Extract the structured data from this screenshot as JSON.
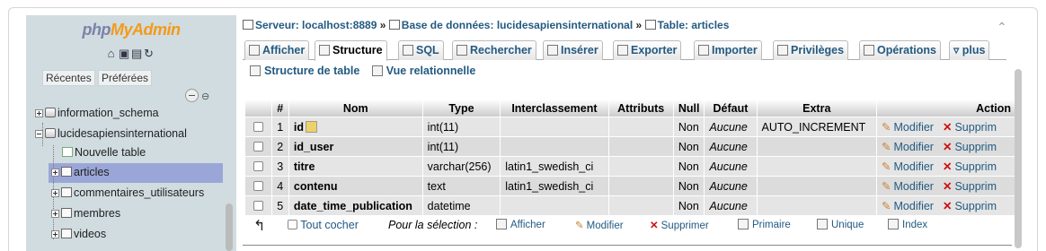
{
  "sidebar": {
    "logo": {
      "php": "php",
      "my": "My",
      "admin": "Admin"
    },
    "tabs": {
      "recent": "Récentes",
      "favorites": "Préférées"
    },
    "tree": [
      {
        "label": "information_schema",
        "kind": "database"
      },
      {
        "label": "lucidesapiensinternational",
        "kind": "database"
      },
      {
        "label": "Nouvelle table",
        "kind": "new"
      },
      {
        "label": "articles",
        "kind": "table",
        "selected": true
      },
      {
        "label": "commentaires_utilisateurs",
        "kind": "table"
      },
      {
        "label": "membres",
        "kind": "table"
      },
      {
        "label": "videos",
        "kind": "table"
      }
    ]
  },
  "breadcrumb": {
    "server": "Serveur: localhost:8889",
    "database": "Base de données: lucidesapiensinternational",
    "table": "Table: articles",
    "sep": "»"
  },
  "tabs": [
    "Afficher",
    "Structure",
    "SQL",
    "Rechercher",
    "Insérer",
    "Exporter",
    "Importer",
    "Privilèges",
    "Opérations",
    "plus"
  ],
  "active_tab": "Structure",
  "subtabs": [
    "Structure de table",
    "Vue relationnelle"
  ],
  "table": {
    "headers": [
      "#",
      "Nom",
      "Type",
      "Interclassement",
      "Attributs",
      "Null",
      "Défaut",
      "Extra",
      "Action"
    ],
    "rows": [
      {
        "num": "1",
        "name": "id",
        "type": "int(11)",
        "collation": "",
        "attributes": "",
        "null": "Non",
        "default": "Aucune",
        "extra": "AUTO_INCREMENT",
        "primary": true
      },
      {
        "num": "2",
        "name": "id_user",
        "type": "int(11)",
        "collation": "",
        "attributes": "",
        "null": "Non",
        "default": "Aucune",
        "extra": ""
      },
      {
        "num": "3",
        "name": "titre",
        "type": "varchar(256)",
        "collation": "latin1_swedish_ci",
        "attributes": "",
        "null": "Non",
        "default": "Aucune",
        "extra": ""
      },
      {
        "num": "4",
        "name": "contenu",
        "type": "text",
        "collation": "latin1_swedish_ci",
        "attributes": "",
        "null": "Non",
        "default": "Aucune",
        "extra": ""
      },
      {
        "num": "5",
        "name": "date_time_publication",
        "type": "datetime",
        "collation": "",
        "attributes": "",
        "null": "Non",
        "default": "Aucune",
        "extra": ""
      }
    ],
    "actions": {
      "modify": "Modifier",
      "delete": "Supprim"
    }
  },
  "bottom": {
    "check_all": "Tout cocher",
    "for_selection": "Pour la sélection :",
    "buttons": [
      "Afficher",
      "Modifier",
      "Supprimer",
      "Primaire",
      "Unique",
      "Index"
    ]
  },
  "colors": {
    "link": "#235a81",
    "sidebar_bg": "#d0dce0",
    "selected_bg": "#9ba6d8",
    "logo_orange": "#f39a1a"
  }
}
